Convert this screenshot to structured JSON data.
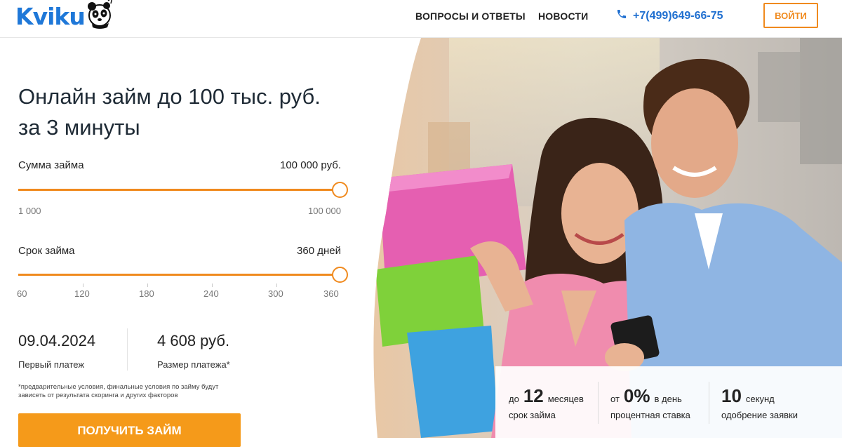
{
  "header": {
    "logo_text": "Kviku",
    "nav": [
      {
        "label": "ВОПРОСЫ И ОТВЕТЫ"
      },
      {
        "label": "НОВОСТИ"
      }
    ],
    "phone": "+7(499)649-66-75",
    "login_label": "ВОЙТИ"
  },
  "hero": {
    "title_line1": "Онлайн займ до 100 тыс. руб.",
    "title_line2": "за 3 минуты"
  },
  "calculator": {
    "amount": {
      "label": "Сумма займа",
      "value": "100 000 руб.",
      "min_label": "1 000",
      "max_label": "100 000",
      "fraction": 1.0
    },
    "term": {
      "label": "Срок займа",
      "value": "360 дней",
      "ticks": [
        "60",
        "120",
        "180",
        "240",
        "300",
        "360"
      ],
      "fraction": 1.0
    }
  },
  "summary": {
    "first_payment_date": "09.04.2024",
    "first_payment_label": "Первый платеж",
    "payment_amount": "4 608 руб.",
    "payment_label": "Размер платежа*"
  },
  "note_line1": "*предварительные условия, финальные условия по займу будут",
  "note_line2": "зависеть от результата скоринга и других факторов",
  "cta_label": "ПОЛУЧИТЬ ЗАЙМ",
  "stats": [
    {
      "prefix": "до",
      "big": "12",
      "suffix": "месяцев",
      "sub": "срок займа"
    },
    {
      "prefix": "от",
      "big": "0%",
      "suffix": "в день",
      "sub": "процентная ставка"
    },
    {
      "prefix": "",
      "big": "10",
      "suffix": "секунд",
      "sub": "одобрение заявки"
    }
  ],
  "colors": {
    "accent": "#f08a1e",
    "brand_blue": "#1f78d8",
    "cta": "#f59a1a"
  }
}
